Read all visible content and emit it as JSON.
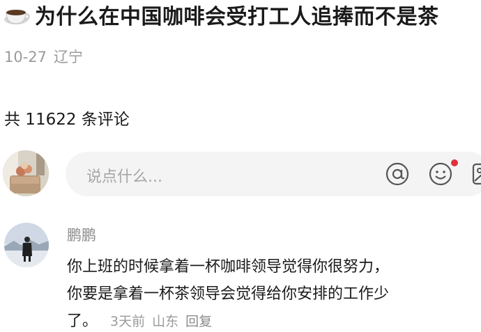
{
  "post": {
    "title": "为什么在中国咖啡会受打工人追捧而不是茶",
    "title_emoji": "coffee-cup-icon",
    "date": "10-27",
    "location": "辽宁"
  },
  "comments_header": {
    "count_text": "共 11622 条评论"
  },
  "composer": {
    "placeholder": "说点什么...",
    "icons": [
      "at-icon",
      "emoji-icon",
      "image-icon"
    ],
    "notification_dot_color": "#e0303c"
  },
  "comment": {
    "author": "鹏鹏",
    "lines": [
      "你上班的时候拿着一杯咖啡领导觉得你很努力，",
      "你要是拿着一杯茶领导会觉得给你安排的工作少",
      "了。"
    ],
    "time": "3天前",
    "location": "山东",
    "reply_label": "回复"
  },
  "colors": {
    "text_primary": "#1a1a1a",
    "text_secondary": "#9a9a9a",
    "input_background": "#f4f4f4"
  }
}
